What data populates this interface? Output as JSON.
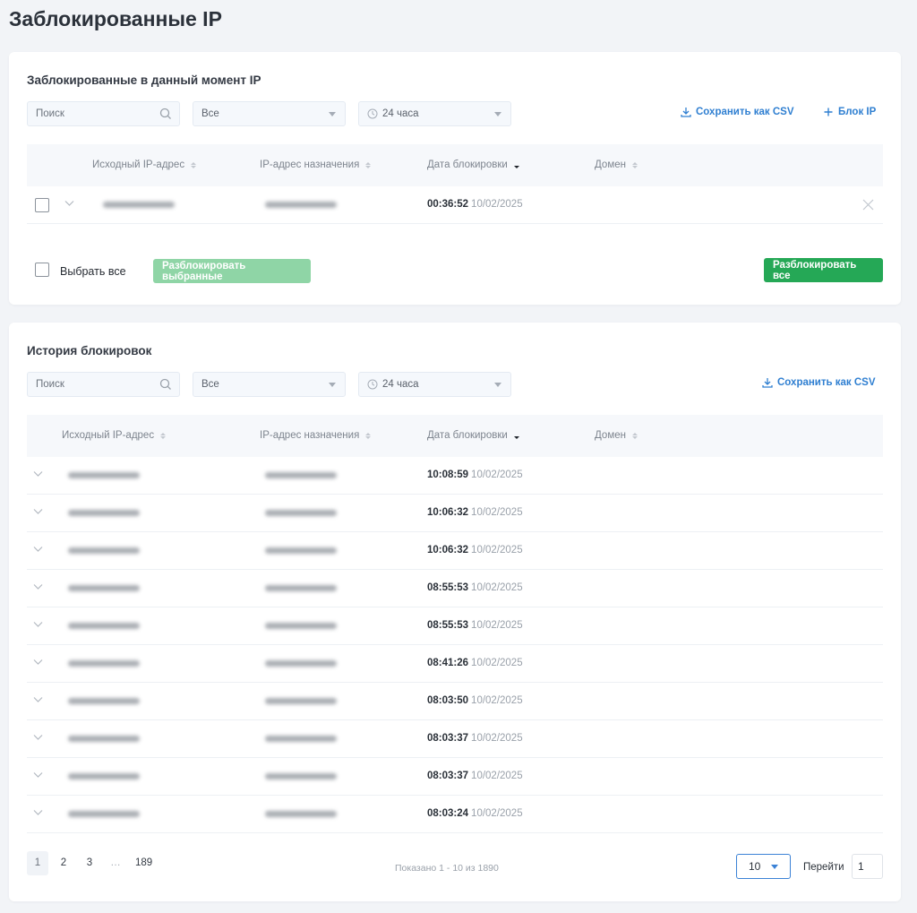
{
  "page": {
    "title": "Заблокированные IP"
  },
  "current": {
    "title": "Заблокированные в данный момент IP",
    "search_placeholder": "Поиск",
    "type_filter": "Все",
    "period_filter": "24 часа",
    "save_csv": "Сохранить как CSV",
    "block_ip": "Блок IP",
    "columns": [
      "Исходный IP-адрес",
      "IP-адрес назначения",
      "Дата блокировки",
      "Домен"
    ],
    "rows": [
      {
        "time": "00:36:52",
        "date": "10/02/2025",
        "domain": ""
      }
    ],
    "select_all": "Выбрать все",
    "unblock_selected": "Разблокировать выбранные",
    "unblock_all": "Разблокировать все"
  },
  "history": {
    "title": "История блокировок",
    "search_placeholder": "Поиск",
    "type_filter": "Все",
    "period_filter": "24 часа",
    "save_csv": "Сохранить как CSV",
    "columns": [
      "Исходный IP-адрес",
      "IP-адрес назначения",
      "Дата блокировки",
      "Домен"
    ],
    "rows": [
      {
        "time": "10:08:59",
        "date": "10/02/2025"
      },
      {
        "time": "10:06:32",
        "date": "10/02/2025"
      },
      {
        "time": "10:06:32",
        "date": "10/02/2025"
      },
      {
        "time": "08:55:53",
        "date": "10/02/2025"
      },
      {
        "time": "08:55:53",
        "date": "10/02/2025"
      },
      {
        "time": "08:41:26",
        "date": "10/02/2025"
      },
      {
        "time": "08:03:50",
        "date": "10/02/2025"
      },
      {
        "time": "08:03:37",
        "date": "10/02/2025"
      },
      {
        "time": "08:03:37",
        "date": "10/02/2025"
      },
      {
        "time": "08:03:24",
        "date": "10/02/2025"
      }
    ],
    "pages": [
      "1",
      "2",
      "3",
      "…",
      "189"
    ],
    "active_page": "1",
    "shown": "Показано 1 - 10 из 1890",
    "per_page": "10",
    "goto_label": "Перейти",
    "goto_value": "1"
  },
  "colors": {
    "accent": "#2f7fd1",
    "success": "#25a856",
    "success_disabled": "#8fd5a6"
  }
}
